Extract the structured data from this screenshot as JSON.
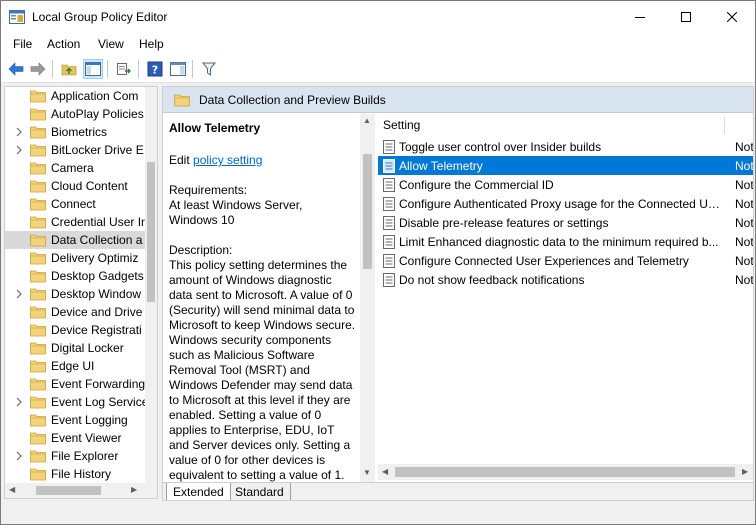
{
  "window": {
    "title": "Local Group Policy Editor"
  },
  "menu": [
    {
      "label": "File"
    },
    {
      "label": "Action"
    },
    {
      "label": "View"
    },
    {
      "label": "Help"
    }
  ],
  "tree": {
    "items": [
      {
        "label": "Application Com",
        "expandable": false
      },
      {
        "label": "AutoPlay Policies",
        "expandable": false
      },
      {
        "label": "Biometrics",
        "expandable": true
      },
      {
        "label": "BitLocker Drive E",
        "expandable": true
      },
      {
        "label": "Camera",
        "expandable": false
      },
      {
        "label": "Cloud Content",
        "expandable": false
      },
      {
        "label": "Connect",
        "expandable": false
      },
      {
        "label": "Credential User In",
        "expandable": false
      },
      {
        "label": "Data Collection a",
        "expandable": false,
        "selected": true
      },
      {
        "label": "Delivery Optimiz",
        "expandable": false
      },
      {
        "label": "Desktop Gadgets",
        "expandable": false
      },
      {
        "label": "Desktop Window",
        "expandable": true
      },
      {
        "label": "Device and Drive",
        "expandable": false
      },
      {
        "label": "Device Registrati",
        "expandable": false
      },
      {
        "label": "Digital Locker",
        "expandable": false
      },
      {
        "label": "Edge UI",
        "expandable": false
      },
      {
        "label": "Event Forwarding",
        "expandable": false
      },
      {
        "label": "Event Log Service",
        "expandable": true
      },
      {
        "label": "Event Logging",
        "expandable": false
      },
      {
        "label": "Event Viewer",
        "expandable": false
      },
      {
        "label": "File Explorer",
        "expandable": true
      },
      {
        "label": "File History",
        "expandable": false
      }
    ]
  },
  "content": {
    "header": "Data Collection and Preview Builds",
    "description": {
      "title": "Allow Telemetry",
      "edit_prefix": "Edit ",
      "edit_link": "policy setting ",
      "requirements": "Requirements:\nAt least Windows Server, Windows 10",
      "description": "Description:\nThis policy setting determines the amount of Windows diagnostic data sent to Microsoft. A value of 0 (Security) will send minimal data to Microsoft to keep Windows secure. Windows security components such as Malicious Software Removal Tool (MSRT) and Windows Defender may send data to Microsoft at this level if they are enabled. Setting a value of 0 applies to Enterprise, EDU, IoT and Server devices only. Setting a value of 0 for other devices is equivalent to setting a value of 1."
    },
    "list": {
      "column_setting": "Setting",
      "rows": [
        {
          "name": "Toggle user control over Insider builds",
          "state": "Not"
        },
        {
          "name": "Allow Telemetry",
          "state": "Not",
          "selected": true
        },
        {
          "name": "Configure the Commercial ID",
          "state": "Not"
        },
        {
          "name": "Configure Authenticated Proxy usage for the Connected Us...",
          "state": "Not"
        },
        {
          "name": "Disable pre-release features or settings",
          "state": "Not"
        },
        {
          "name": "Limit Enhanced diagnostic data to the minimum required b...",
          "state": "Not"
        },
        {
          "name": "Configure Connected User Experiences and Telemetry",
          "state": "Not"
        },
        {
          "name": "Do not show feedback notifications",
          "state": "Not"
        }
      ]
    },
    "tabs": [
      {
        "label": "Extended",
        "active": true
      },
      {
        "label": "Standard",
        "active": false
      }
    ]
  }
}
